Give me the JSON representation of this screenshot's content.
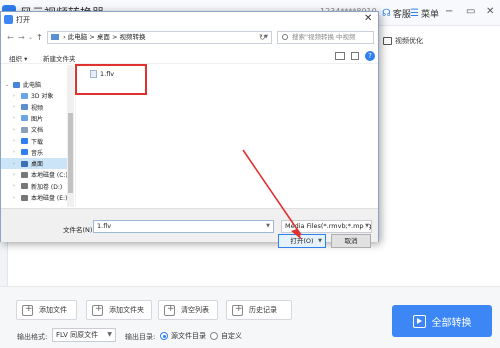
{
  "app": {
    "title": "风云视频转换器",
    "account": "1234****8910",
    "service_label": "客服",
    "menu_label": "菜单",
    "video_optimize_label": "视频优化"
  },
  "dialog": {
    "title": "打开",
    "address": {
      "path": [
        "此电脑",
        "桌面",
        "视频转换"
      ],
      "separator": ">"
    },
    "search_placeholder": "搜索\"视频转换 中视频",
    "organize_label": "组织 ▾",
    "new_folder_label": "新建文件夹",
    "nav_items": [
      {
        "label": "此电脑",
        "icon": "computer-icon",
        "color": "#4a86d6"
      },
      {
        "label": "3D 对象",
        "icon": "cube-icon",
        "color": "#6aa6e6"
      },
      {
        "label": "视频",
        "icon": "video-icon",
        "color": "#5c8fd0"
      },
      {
        "label": "图片",
        "icon": "picture-icon",
        "color": "#6aa6e6"
      },
      {
        "label": "文档",
        "icon": "document-icon",
        "color": "#8aa0b8"
      },
      {
        "label": "下载",
        "icon": "download-icon",
        "color": "#2f7ff0"
      },
      {
        "label": "音乐",
        "icon": "music-icon",
        "color": "#2f7ff0"
      },
      {
        "label": "桌面",
        "icon": "desktop-icon",
        "color": "#3a6fb5"
      },
      {
        "label": "本地磁盘 (C:)",
        "icon": "drive-icon",
        "color": "#777777"
      },
      {
        "label": "新加卷 (D:)",
        "icon": "drive-icon",
        "color": "#777777"
      },
      {
        "label": "本地磁盘 (E:)",
        "icon": "drive-icon",
        "color": "#777777"
      }
    ],
    "selected_nav": "桌面",
    "files": [
      {
        "name": "1.flv",
        "icon": "video-file-icon"
      }
    ],
    "filename_label": "文件名(N):",
    "filename_value": "1.flv",
    "filetype_value": "Media Files(*.rmvb;*.mpeg;*.m",
    "open_label": "打开(O)",
    "cancel_label": "取消"
  },
  "toolbar": {
    "add_file": "添加文件",
    "add_folder": "添加文件夹",
    "clear_list": "清空列表",
    "history": "历史记录"
  },
  "output": {
    "format_label": "输出格式:",
    "format_value": "FLV 同原文件",
    "dir_label": "输出目录:",
    "dir_options": [
      "源文件目录",
      "自定义"
    ],
    "dir_selected": "源文件目录"
  },
  "convert_all_label": "全部转换",
  "colors": {
    "accent": "#3c86f5",
    "annotation": "#e0312e"
  }
}
